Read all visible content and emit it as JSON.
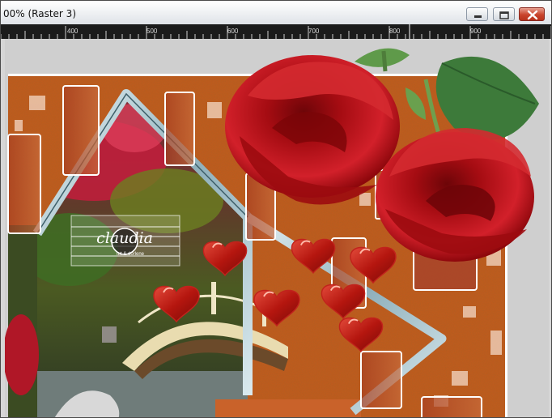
{
  "window": {
    "title": "00% (Raster 3)",
    "buttons": {
      "minimize": "minimize",
      "maximize": "maximize",
      "close": "close"
    }
  },
  "ruler": {
    "labels": [
      "400",
      "500",
      "600",
      "700",
      "800",
      "900"
    ]
  },
  "canvas": {
    "watermark_main": "claudia",
    "watermark_sub": "tut & dorlene",
    "colors": {
      "background": "#c35a1c",
      "rose": "#b81018",
      "heart": "#c1221c",
      "frame_glass": "#a9c7d0"
    }
  }
}
